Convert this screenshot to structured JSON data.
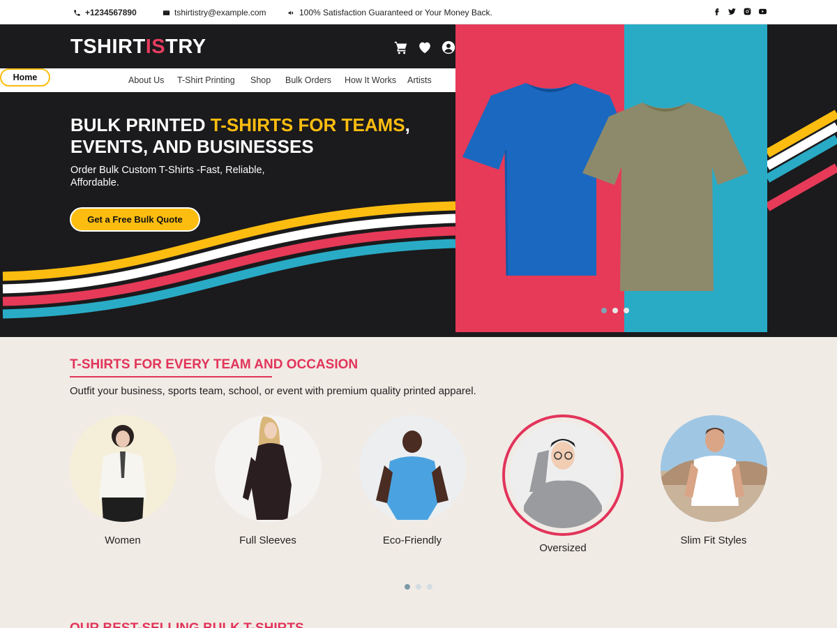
{
  "topbar": {
    "phone": "+1234567890",
    "email": "tshirtistry@example.com",
    "promise": "100% Satisfaction Guaranteed or Your Money Back.",
    "icons": [
      "phone-icon",
      "envelope-icon",
      "megaphone-icon"
    ],
    "socials": [
      "facebook-icon",
      "twitter-icon",
      "instagram-icon",
      "youtube-icon"
    ]
  },
  "header": {
    "logo_part1": "TSHIRT",
    "logo_part2": "IS",
    "logo_part3": "TRY",
    "icons": [
      "cart-icon",
      "heart-icon",
      "user-icon"
    ]
  },
  "nav": {
    "items": [
      {
        "label": "Home",
        "active": true
      },
      {
        "label": "About Us"
      },
      {
        "label": "T-Shirt Printing"
      },
      {
        "label": "Shop"
      },
      {
        "label": "Bulk Orders"
      },
      {
        "label": "How It Works"
      },
      {
        "label": "Artists"
      }
    ]
  },
  "hero": {
    "title_part1": "BULK PRINTED ",
    "title_highlight": "T-SHIRTS FOR TEAMS",
    "title_part2": ", EVENTS, AND BUSINESSES",
    "subtitle": "Order Bulk Custom T-Shirts -Fast, Reliable, Affordable.",
    "cta": "Get a Free Bulk Quote",
    "slide_count": 3,
    "active_slide": 1
  },
  "categories_section": {
    "title": "T-SHIRTS FOR EVERY TEAM AND OCCASION",
    "subtitle": "Outfit your business, sports team, school, or event with premium quality printed apparel.",
    "items": [
      {
        "label": "Women"
      },
      {
        "label": "Full Sleeves"
      },
      {
        "label": "Eco-Friendly"
      },
      {
        "label": "Oversized",
        "featured": true
      },
      {
        "label": "Slim Fit Styles"
      }
    ],
    "page_count": 3,
    "active_page": 1
  },
  "next_section": {
    "title": "OUR BEST-SELLING BULK T-SHIRTS"
  },
  "colors": {
    "accent_red": "#e2345a",
    "accent_yellow": "#fdbd10",
    "accent_blue": "#29abc6",
    "dark": "#1b1a1c",
    "section_bg": "#f1ebe5"
  }
}
